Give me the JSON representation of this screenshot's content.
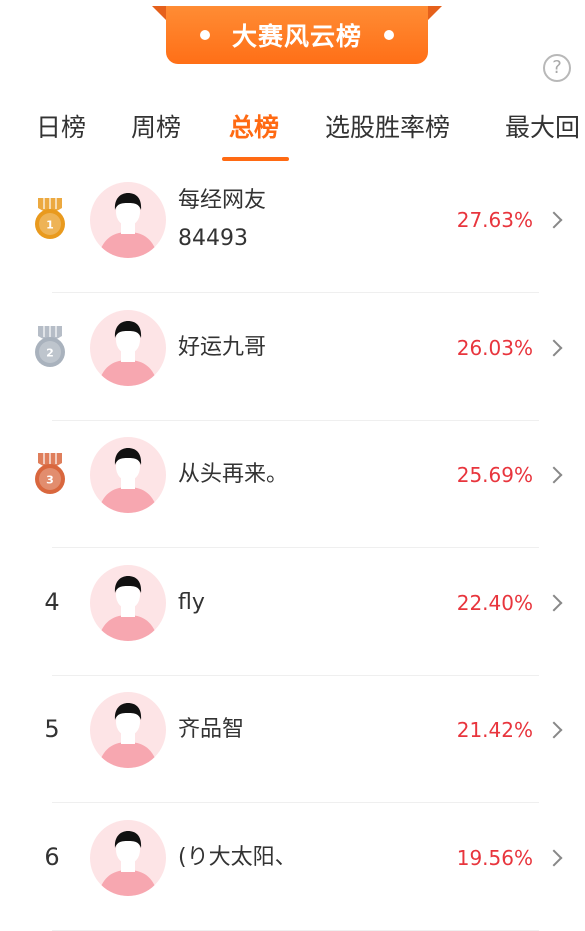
{
  "header": {
    "title": "大赛风云榜",
    "help_icon": "?"
  },
  "tabs": [
    {
      "label": "日榜",
      "active": false
    },
    {
      "label": "周榜",
      "active": false
    },
    {
      "label": "总榜",
      "active": true
    },
    {
      "label": "选股胜率榜",
      "active": false
    },
    {
      "label": "最大回",
      "active": false
    }
  ],
  "rankings": [
    {
      "rank": "1",
      "medal": "gold",
      "name_line1": "每经网友",
      "name_line2": "84493",
      "rate": "27.63%"
    },
    {
      "rank": "2",
      "medal": "silver",
      "name_line1": "好运九哥",
      "name_line2": "",
      "rate": "26.03%"
    },
    {
      "rank": "3",
      "medal": "bronze",
      "name_line1": "从头再来。",
      "name_line2": "",
      "rate": "25.69%"
    },
    {
      "rank": "4",
      "medal": "",
      "name_line1": "fly",
      "name_line2": "",
      "rate": "22.40%"
    },
    {
      "rank": "5",
      "medal": "",
      "name_line1": "齐品智",
      "name_line2": "",
      "rate": "21.42%"
    },
    {
      "rank": "6",
      "medal": "",
      "name_line1": "(り大太阳、",
      "name_line2": "",
      "rate": "19.56%"
    }
  ],
  "colors": {
    "accent": "#ff6a13",
    "rate": "#e8353d",
    "gold": "#e99a1e",
    "silver": "#a9b2bd",
    "bronze": "#d9673e"
  }
}
